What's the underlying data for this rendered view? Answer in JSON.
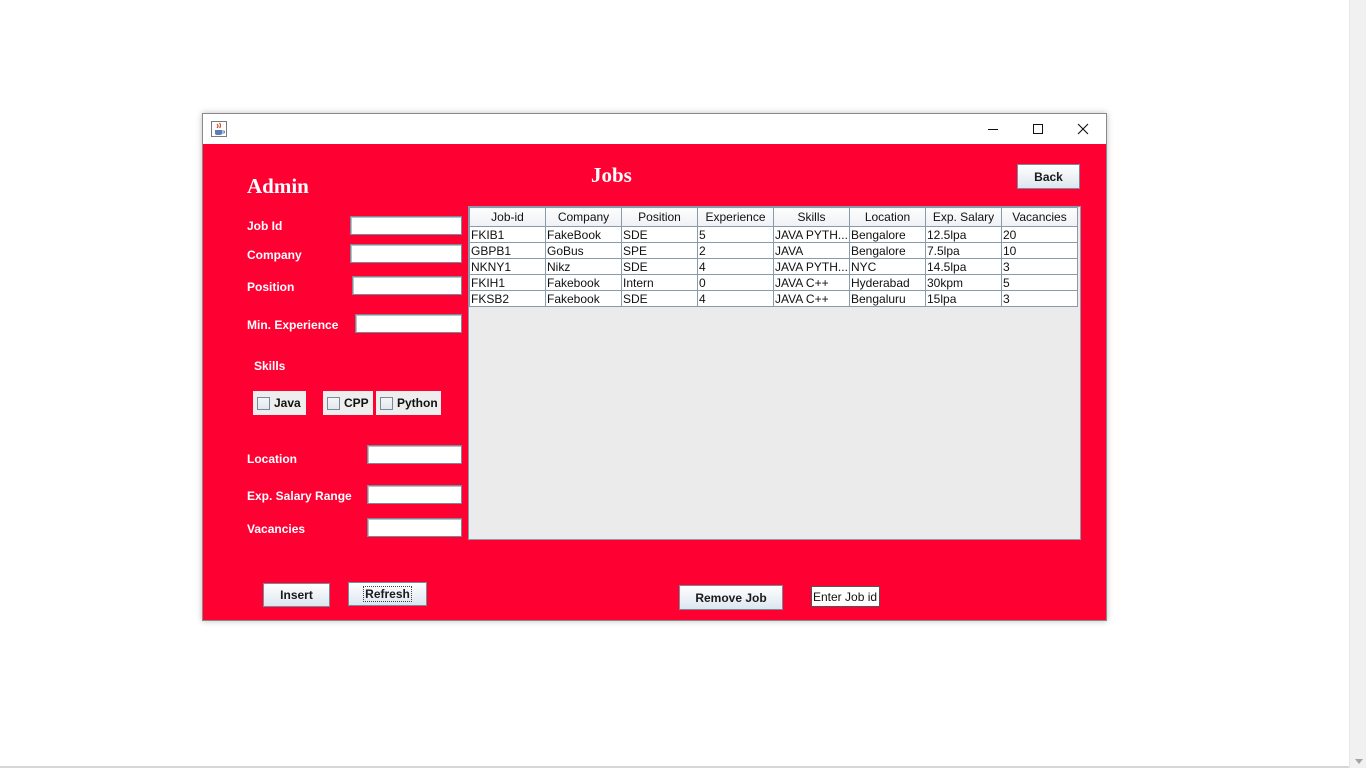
{
  "window": {
    "title": ""
  },
  "form": {
    "heading": "Admin",
    "fields": {
      "job_id": {
        "label": "Job Id",
        "value": ""
      },
      "company": {
        "label": "Company",
        "value": ""
      },
      "position": {
        "label": "Position",
        "value": ""
      },
      "min_experience": {
        "label": "Min. Experience",
        "value": ""
      },
      "location": {
        "label": "Location",
        "value": ""
      },
      "salary_range": {
        "label": "Exp. Salary Range",
        "value": ""
      },
      "vacancies": {
        "label": "Vacancies",
        "value": ""
      }
    },
    "skills_label": "Skills",
    "skills": [
      {
        "label": "Java",
        "checked": false
      },
      {
        "label": "CPP",
        "checked": false
      },
      {
        "label": "Python",
        "checked": false
      }
    ],
    "insert_label": "Insert",
    "refresh_label": "Refresh"
  },
  "jobs": {
    "heading": "Jobs",
    "back_label": "Back",
    "columns": [
      "Job-id",
      "Company",
      "Position",
      "Experience",
      "Skills",
      "Location",
      "Exp. Salary",
      "Vacancies"
    ],
    "rows": [
      [
        "FKIB1",
        "FakeBook",
        "SDE",
        "5",
        "JAVA  PYTH...",
        "Bengalore",
        "12.5lpa",
        "20"
      ],
      [
        "GBPB1",
        "GoBus",
        "SPE",
        "2",
        "JAVA",
        "Bengalore",
        "7.5lpa",
        "10"
      ],
      [
        "NKNY1",
        "Nikz",
        "SDE",
        "4",
        "JAVA  PYTH...",
        "NYC",
        "14.5lpa",
        "3"
      ],
      [
        "FKIH1",
        "Fakebook",
        "Intern",
        "0",
        "JAVA C++",
        "Hyderabad",
        "30kpm",
        "5"
      ],
      [
        "FKSB2",
        "Fakebook",
        "SDE",
        "4",
        "JAVA C++",
        "Bengaluru",
        "15lpa",
        "3"
      ]
    ],
    "remove_label": "Remove Job",
    "remove_input_value": "Enter Job id"
  },
  "colors": {
    "background": "#ff0033",
    "text": "#ffffff"
  },
  "icons": {
    "app": "java-cup-icon",
    "minimize": "minimize-icon",
    "maximize": "maximize-icon",
    "close": "close-icon"
  }
}
